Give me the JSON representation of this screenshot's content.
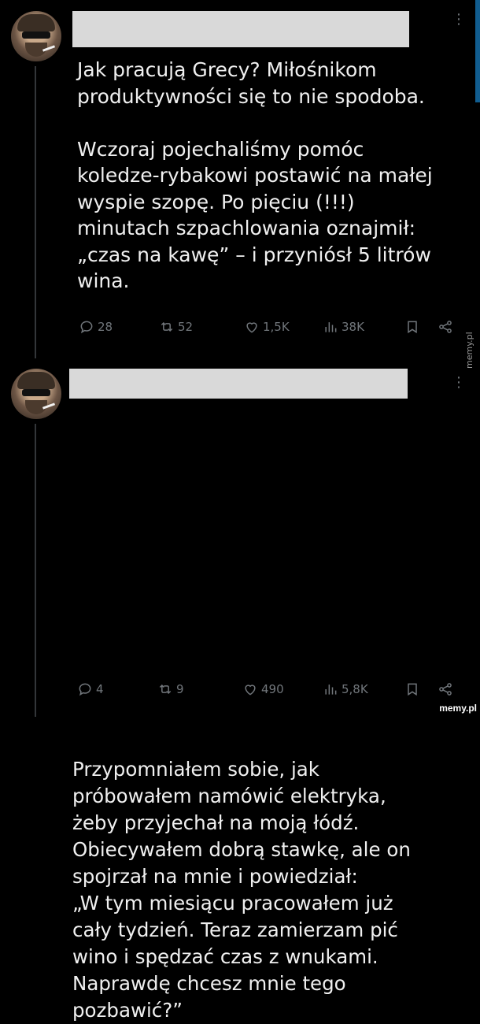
{
  "tweets": [
    {
      "text": "Jak pracują Grecy? Miłośnikom\nproduktywności się to nie spodoba.\n\nWczoraj pojechaliśmy pomóc\nkoledze-rybakowi postawić na małej\nwyspie szopę. Po pięciu (!!!)\nminutach szpachlowania oznajmił:\n„czas na kawę” – i przyniósł 5 litrów\nwina.",
      "replies": "28",
      "retweets": "52",
      "likes": "1,5K",
      "views": "38K"
    },
    {
      "text": "Przypomniałem sobie, jak\npróbowałem namówić elektryka,\nżeby przyjechał na moją łódź.\nObiecywałem dobrą stawkę, ale on\nspojrzał na mnie i powiedział:\n„W tym miesiącu pracowałem już\ncały tydzień. Teraz zamierzam pić\nwino i spędzać czas z wnukami.\nNaprawdę chcesz mnie tego\npozbawić?”",
      "replies": "4",
      "retweets": "9",
      "likes": "490",
      "views": "5,8K"
    }
  ],
  "watermarks": {
    "side": "memy.pl",
    "bottom": "memy.pl"
  },
  "colors": {
    "background": "#000000",
    "text": "#f0f0f0",
    "muted": "#71767b",
    "redaction": "#d9d9d9"
  }
}
